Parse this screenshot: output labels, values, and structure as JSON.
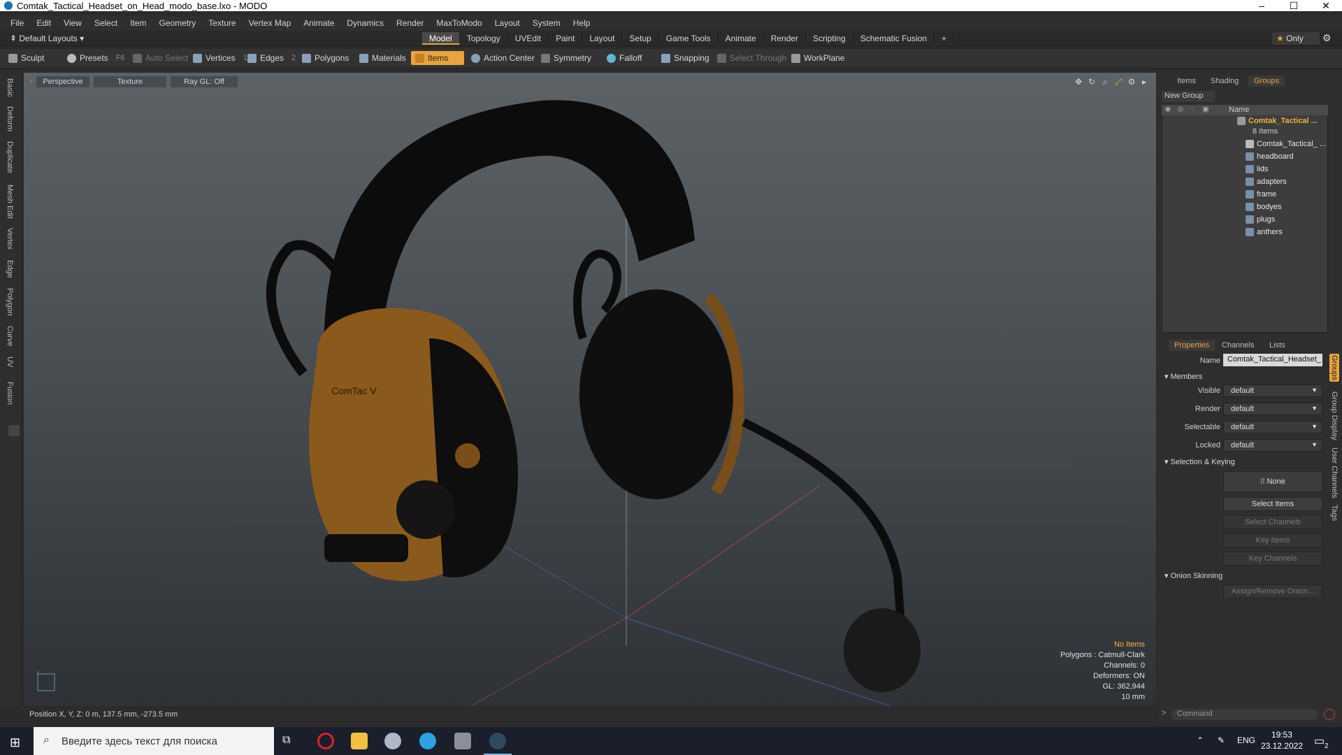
{
  "window": {
    "title": "Comtak_Tactical_Headset_on_Head_modo_base.lxo - MODO"
  },
  "menu": [
    "File",
    "Edit",
    "View",
    "Select",
    "Item",
    "Geometry",
    "Texture",
    "Vertex Map",
    "Animate",
    "Dynamics",
    "Render",
    "MaxToModo",
    "Layout",
    "System",
    "Help"
  ],
  "layout_dropdown": "Default Layouts",
  "mode_tabs": [
    "Model",
    "Topology",
    "UVEdit",
    "Paint",
    "Layout",
    "Setup",
    "Game Tools",
    "Animate",
    "Render",
    "Scripting",
    "Schematic Fusion"
  ],
  "only_button": "Only",
  "toolbar": {
    "sculpt": "Sculpt",
    "presets": "Presets",
    "presets_key": "F6",
    "auto_select": "Auto Select",
    "vertices": "Vertices",
    "vertices_count": "1",
    "edges": "Edges",
    "edges_count": "2",
    "polygons": "Polygons",
    "materials": "Materials",
    "items": "Items",
    "action_center": "Action Center",
    "symmetry": "Symmetry",
    "falloff": "Falloff",
    "snapping": "Snapping",
    "select_through": "Select Through",
    "workplane": "WorkPlane"
  },
  "left_tabs": [
    "Basic",
    "Deform",
    "Duplicate",
    "Mesh Edit",
    "Vertex",
    "Edge",
    "Polygon",
    "Curve",
    "UV",
    "Fusion"
  ],
  "viewport": {
    "perspective": "Perspective",
    "texture": "Texture",
    "ray_gl": "Ray GL: Off",
    "info": {
      "no_items": "No Items",
      "polygons": "Polygons : Catmull-Clark",
      "channels": "Channels: 0",
      "deformers": "Deformers: ON",
      "gl": "GL: 362,944",
      "scale": "10 mm"
    },
    "logo_text": "ComTac V"
  },
  "status": {
    "position": "Position X, Y, Z:   0 m, 137.5 mm, -273.5 mm"
  },
  "right_panel": {
    "top_tabs": [
      "Items",
      "Shading",
      "Groups"
    ],
    "new_group": "New Group",
    "name_header": "Name",
    "root": {
      "label": "Comtak_Tactical ...",
      "count": "8 Items"
    },
    "items": [
      "Comtak_Tactical_ ...",
      "headboard",
      "lids",
      "adapters",
      "frame",
      "bodyes",
      "plugs",
      "anthers"
    ],
    "prop_tabs": [
      "Properties",
      "Channels",
      "Lists"
    ],
    "name_label": "Name",
    "name_value": "Comtak_Tactical_Headset_",
    "members": "Members",
    "visible_label": "Visible",
    "visible_value": "default",
    "render_label": "Render",
    "render_value": "default",
    "selectable_label": "Selectable",
    "selectable_value": "default",
    "locked_label": "Locked",
    "locked_value": "default",
    "selection_keying": "Selection & Keying",
    "none_btn": "None",
    "select_items": "Select Items",
    "select_channels": "Select Channels",
    "key_items": "Key Items",
    "key_channels": "Key Channels",
    "onion_skinning": "Onion Skinning",
    "assign_remove": "Assign/Remove Onion...",
    "side_tabs": [
      "Groups",
      "Group Display",
      "User Channels",
      "Tags"
    ],
    "command_placeholder": "Command"
  },
  "taskbar": {
    "search_placeholder": "Введите здесь текст для поиска",
    "lang": "ENG",
    "time": "19:53",
    "date": "23.12.2022",
    "notif_badge": "2"
  }
}
